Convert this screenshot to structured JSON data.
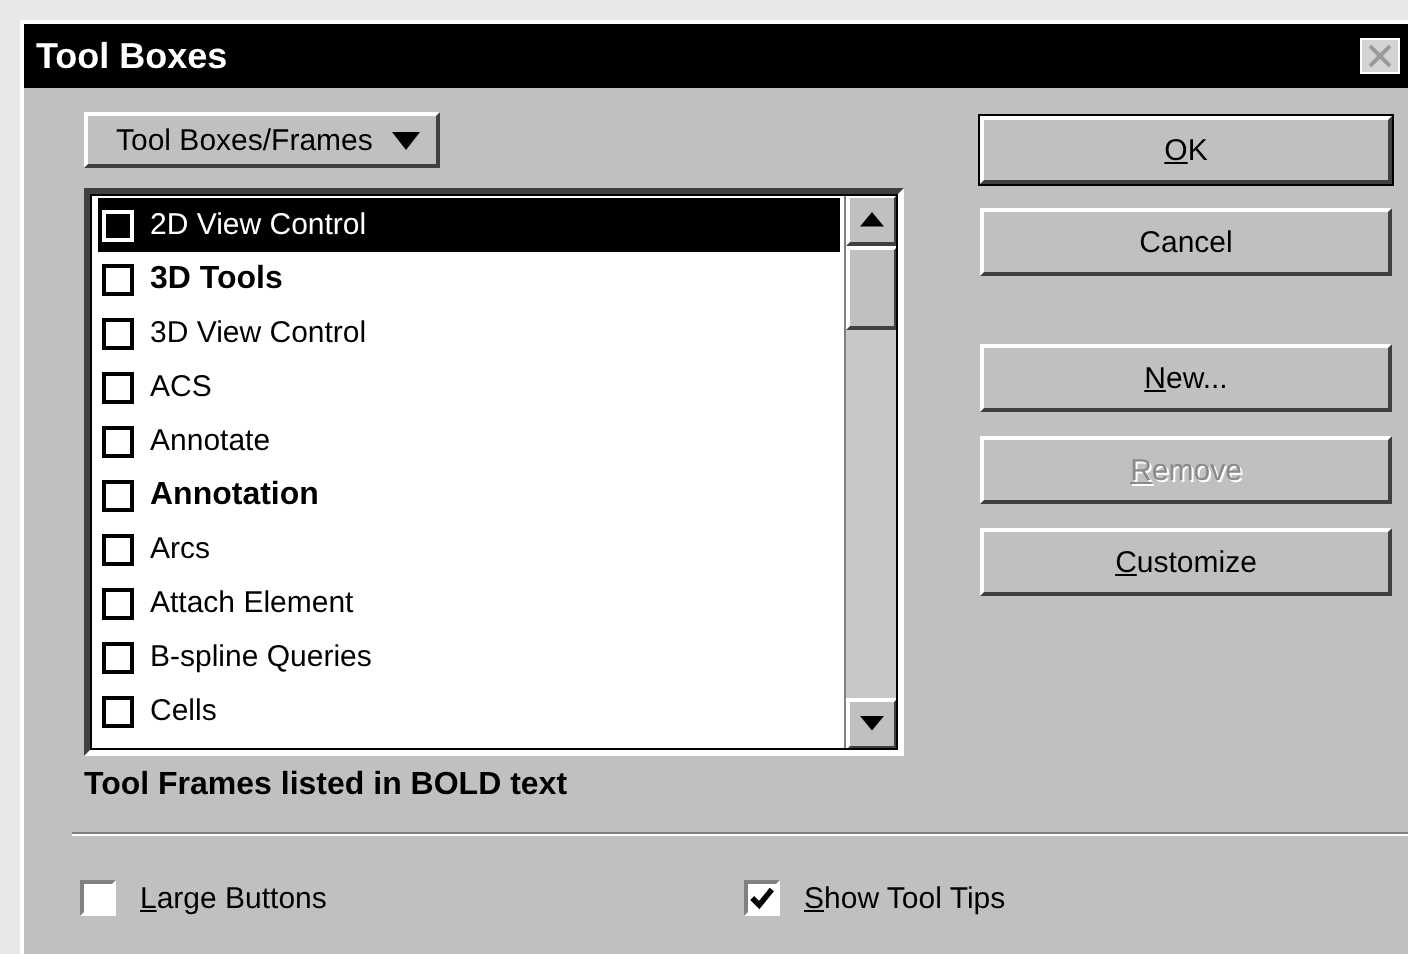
{
  "window": {
    "title": "Tool Boxes"
  },
  "view_menu": {
    "label": "Tool Boxes/Frames"
  },
  "items": [
    {
      "label": "2D View Control",
      "bold": false,
      "checked": false,
      "selected": true
    },
    {
      "label": "3D Tools",
      "bold": true,
      "checked": false,
      "selected": false
    },
    {
      "label": "3D View Control",
      "bold": false,
      "checked": false,
      "selected": false
    },
    {
      "label": "ACS",
      "bold": false,
      "checked": false,
      "selected": false
    },
    {
      "label": "Annotate",
      "bold": false,
      "checked": false,
      "selected": false
    },
    {
      "label": "Annotation",
      "bold": true,
      "checked": false,
      "selected": false
    },
    {
      "label": "Arcs",
      "bold": false,
      "checked": false,
      "selected": false
    },
    {
      "label": "Attach Element",
      "bold": false,
      "checked": false,
      "selected": false
    },
    {
      "label": "B-spline Queries",
      "bold": false,
      "checked": false,
      "selected": false
    },
    {
      "label": "Cells",
      "bold": false,
      "checked": false,
      "selected": false
    }
  ],
  "legend": "Tool Frames listed in BOLD text",
  "buttons": [
    {
      "key": "O",
      "rest": "K",
      "default": true,
      "disabled": false
    },
    {
      "rest": "Cancel",
      "default": false,
      "disabled": false
    },
    {
      "key": "N",
      "rest": "ew...",
      "default": false,
      "disabled": false
    },
    {
      "key": "R",
      "rest": "emove",
      "default": false,
      "disabled": true
    },
    {
      "key": "C",
      "rest": "ustomize",
      "default": false,
      "disabled": false
    }
  ],
  "options": [
    {
      "key": "L",
      "rest": "arge Buttons",
      "checked": false
    },
    {
      "key": "S",
      "rest": "how Tool Tips",
      "checked": true
    }
  ]
}
